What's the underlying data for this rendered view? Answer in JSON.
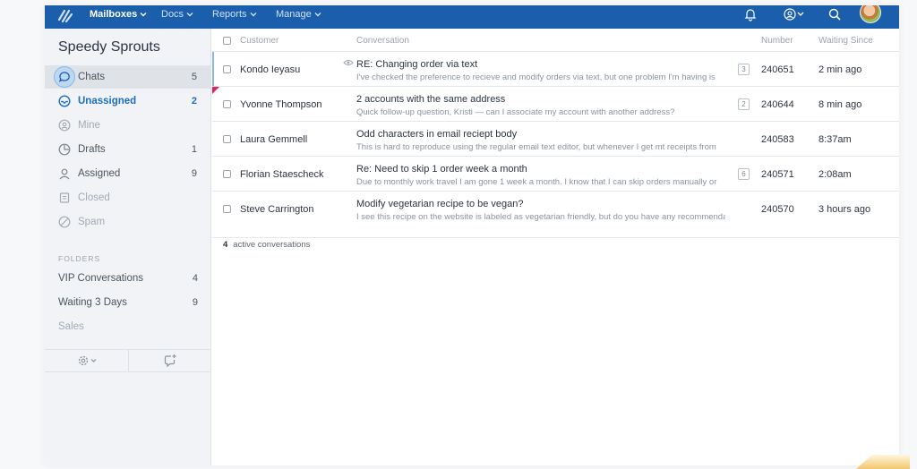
{
  "topbar": {
    "nav": [
      {
        "label": "Mailboxes"
      },
      {
        "label": "Docs"
      },
      {
        "label": "Reports"
      },
      {
        "label": "Manage"
      }
    ]
  },
  "sidebar": {
    "mailbox_name": "Speedy Sprouts",
    "items": [
      {
        "label": "Chats",
        "count": "5",
        "icon": "chat-icon"
      },
      {
        "label": "Unassigned",
        "count": "2",
        "icon": "inbox-icon"
      },
      {
        "label": "Mine",
        "count": "",
        "icon": "person-circle-icon"
      },
      {
        "label": "Drafts",
        "count": "1",
        "icon": "draft-icon"
      },
      {
        "label": "Assigned",
        "count": "9",
        "icon": "user-icon"
      },
      {
        "label": "Closed",
        "count": "",
        "icon": "archive-icon"
      },
      {
        "label": "Spam",
        "count": "",
        "icon": "spam-icon"
      }
    ],
    "folders_heading": "FOLDERS",
    "folders": [
      {
        "label": "VIP Conversations",
        "count": "4"
      },
      {
        "label": "Waiting 3 Days",
        "count": "9"
      },
      {
        "label": "Sales",
        "count": ""
      }
    ]
  },
  "table": {
    "headers": {
      "customer": "Customer",
      "conversation": "Conversation",
      "number": "Number",
      "waiting": "Waiting Since"
    },
    "rows": [
      {
        "customer": "Kondo Ieyasu",
        "subject": "RE: Changing order via text",
        "preview": "I've checked the preference to recieve and modify orders via text, but one problem I'm having is",
        "threads": "3",
        "number": "240651",
        "waiting": "2 min ago"
      },
      {
        "customer": "Yvonne Thompson",
        "subject": "2 accounts with the same address",
        "preview": "Quick follow-up question, Kristi — can I associate my account with another address?",
        "threads": "2",
        "number": "240644",
        "waiting": "8 min ago"
      },
      {
        "customer": "Laura Gemmell",
        "subject": "Odd characters in email reciept body",
        "preview": "This is hard to reproduce using the regular email text editor, but whenever I get mt receipts from",
        "threads": "",
        "number": "240583",
        "waiting": "8:37am"
      },
      {
        "customer": "Florian Staescheck",
        "subject": "Re: Need to skip 1 order week a month",
        "preview": "Due to monthly work travel I am gone 1 week a month. I know that I can skip orders manually or",
        "threads": "6",
        "number": "240571",
        "waiting": "2:08am"
      },
      {
        "customer": "Steve Carrington",
        "subject": "Modify vegetarian recipe to be vegan?",
        "preview": "I see this recipe on the website is labeled as vegetarian friendly, but do you have any recommendations",
        "threads": "",
        "number": "240570",
        "waiting": "3 hours ago"
      }
    ],
    "footer": {
      "count": "4",
      "label": "active conversations"
    }
  },
  "colors": {
    "topbar": "#1b5eab",
    "accent": "#1b6ec2",
    "flag": "#e0245e"
  }
}
